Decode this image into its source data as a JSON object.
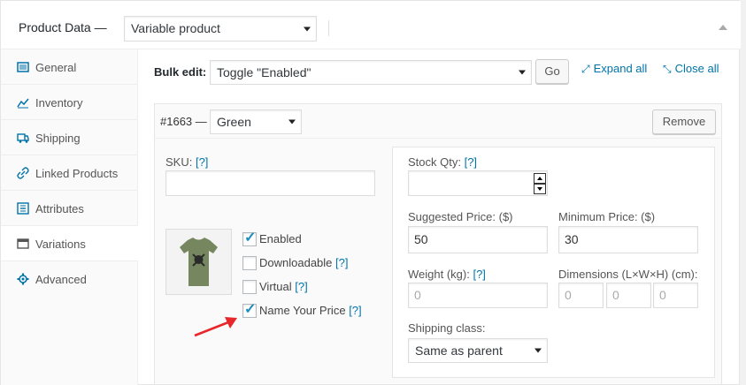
{
  "header": {
    "title": "Product Data —",
    "product_type": "Variable product"
  },
  "tabs": [
    {
      "label": "General",
      "icon": "general-icon"
    },
    {
      "label": "Inventory",
      "icon": "inventory-icon"
    },
    {
      "label": "Shipping",
      "icon": "shipping-icon"
    },
    {
      "label": "Linked Products",
      "icon": "linked-products-icon"
    },
    {
      "label": "Attributes",
      "icon": "attributes-icon"
    },
    {
      "label": "Variations",
      "icon": "variations-icon",
      "active": true
    },
    {
      "label": "Advanced",
      "icon": "advanced-icon"
    }
  ],
  "toolbar": {
    "bulk_edit_label": "Bulk edit:",
    "bulk_edit_value": "Toggle \"Enabled\"",
    "go_label": "Go",
    "expand_all": "Expand all",
    "close_all": "Close all"
  },
  "variation": {
    "id": "#1663 —",
    "attribute_value": "Green",
    "remove_label": "Remove",
    "sku_label": "SKU:",
    "help": "[?]",
    "sku_value": "",
    "checkboxes": [
      {
        "label": "Enabled",
        "checked": true
      },
      {
        "label": "Downloadable",
        "checked": false,
        "help": "[?]"
      },
      {
        "label": "Virtual",
        "checked": false,
        "help": "[?]"
      },
      {
        "label": "Name Your Price",
        "checked": true,
        "help": "[?]"
      }
    ],
    "stock_qty_label": "Stock Qty:",
    "stock_qty_value": "",
    "suggested_price_label": "Suggested Price: ($)",
    "suggested_price_value": "50",
    "minimum_price_label": "Minimum Price: ($)",
    "minimum_price_value": "30",
    "weight_label": "Weight (kg):",
    "weight_placeholder": "0",
    "dimensions_label": "Dimensions (L×W×H) (cm):",
    "dimensions_placeholders": [
      "0",
      "0",
      "0"
    ],
    "shipping_class_label": "Shipping class:",
    "shipping_class_value": "Same as parent"
  },
  "colors": {
    "link": "#0073aa",
    "checkbox_tick": "#1e8cbe",
    "annotation_arrow": "#e8272b",
    "tshirt": "#76875f"
  }
}
